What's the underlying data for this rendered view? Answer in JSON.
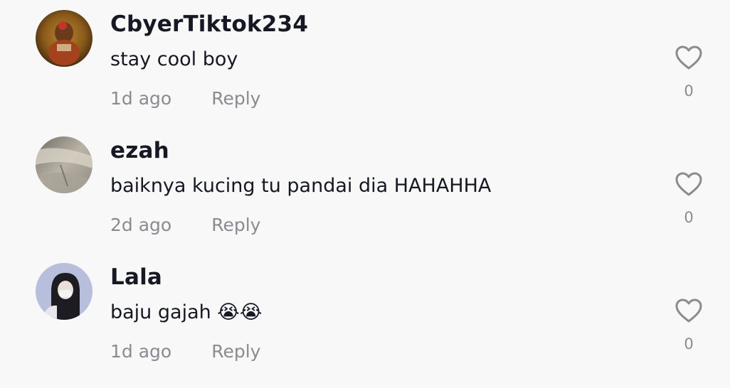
{
  "comments": [
    {
      "username": "CbyerTiktok234",
      "text": "stay cool boy",
      "time": "1d ago",
      "reply_label": "Reply",
      "likes": "0"
    },
    {
      "username": "ezah",
      "text": "baiknya kucing tu pandai dia HAHAHHA",
      "time": "2d ago",
      "reply_label": "Reply",
      "likes": "0"
    },
    {
      "username": "Lala",
      "text": "baju gajah 😭😭",
      "time": "1d ago",
      "reply_label": "Reply",
      "likes": "0"
    }
  ],
  "icons": {
    "like": "heart-outline-icon"
  },
  "colors": {
    "background": "#f8f8f8",
    "primary_text": "#161823",
    "secondary_text": "#8a8b91"
  }
}
